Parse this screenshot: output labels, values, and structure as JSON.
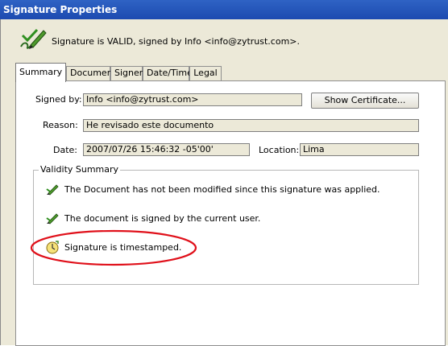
{
  "window": {
    "title": "Signature Properties"
  },
  "status": {
    "text": "Signature is VALID, signed by Info <info@zytrust.com>."
  },
  "tabs": [
    {
      "label": "Summary",
      "active": true
    },
    {
      "label": "Document",
      "active": false
    },
    {
      "label": "Signer",
      "active": false
    },
    {
      "label": "Date/Time",
      "active": false
    },
    {
      "label": "Legal",
      "active": false
    }
  ],
  "summary": {
    "signed_by_label": "Signed by:",
    "signed_by_value": "Info <info@zytrust.com>",
    "show_certificate_label": "Show Certificate...",
    "reason_label": "Reason:",
    "reason_value": "He revisado este documento",
    "date_label": "Date:",
    "date_value": "2007/07/26 15:46:32 -05'00'",
    "location_label": "Location:",
    "location_value": "Lima"
  },
  "validity": {
    "title": "Validity Summary",
    "items": [
      {
        "text": "The Document has not been modified since this signature was applied.",
        "icon": "valid-signature-pen-icon"
      },
      {
        "text": "The document is signed by the current user.",
        "icon": "valid-signature-pen-icon"
      },
      {
        "text": "Signature is timestamped.",
        "icon": "timestamp-clock-icon"
      }
    ]
  },
  "colors": {
    "titlebar": "#2f63c4",
    "dialog_bg": "#ece9d8",
    "highlight_ellipse": "#e0101a"
  }
}
